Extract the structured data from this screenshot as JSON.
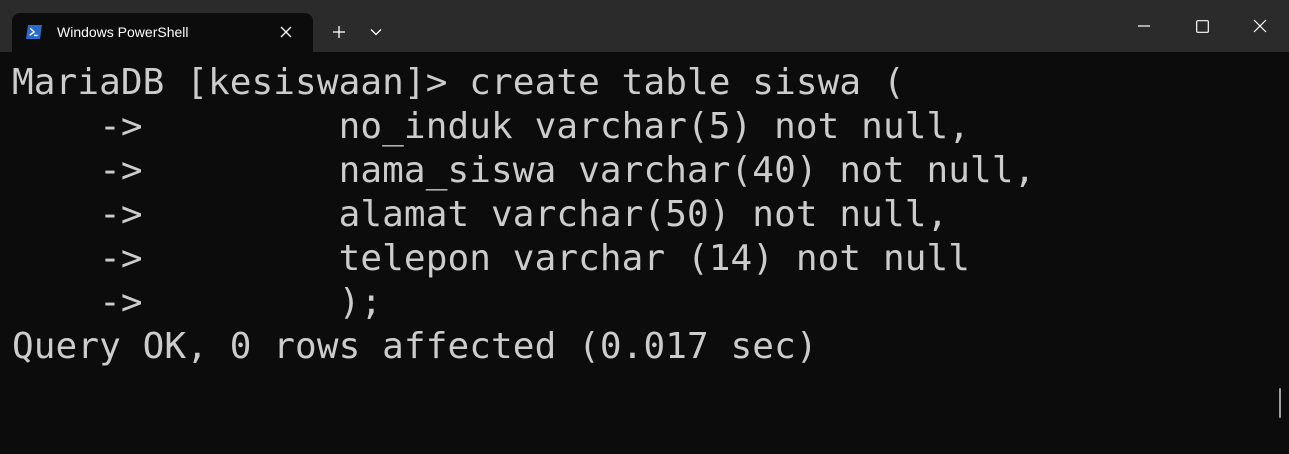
{
  "tab": {
    "title": "Windows PowerShell",
    "icon": "powershell-icon",
    "accent": "#2a6acb"
  },
  "toolbar": {
    "new_tab_icon": "plus-icon",
    "dropdown_icon": "chevron-down-icon"
  },
  "window_controls": {
    "minimize_icon": "minimize-icon",
    "maximize_icon": "maximize-icon",
    "close_icon": "close-icon"
  },
  "colors": {
    "titlebar": "#2b2b2b",
    "background": "#0c0c0c",
    "text": "#cccccc"
  },
  "terminal": {
    "lines": [
      "MariaDB [kesiswaan]> create table siswa (",
      "    ->         no_induk varchar(5) not null,",
      "    ->         nama_siswa varchar(40) not null,",
      "    ->         alamat varchar(50) not null,",
      "    ->         telepon varchar (14) not null",
      "    ->         );",
      "Query OK, 0 rows affected (0.017 sec)"
    ]
  }
}
